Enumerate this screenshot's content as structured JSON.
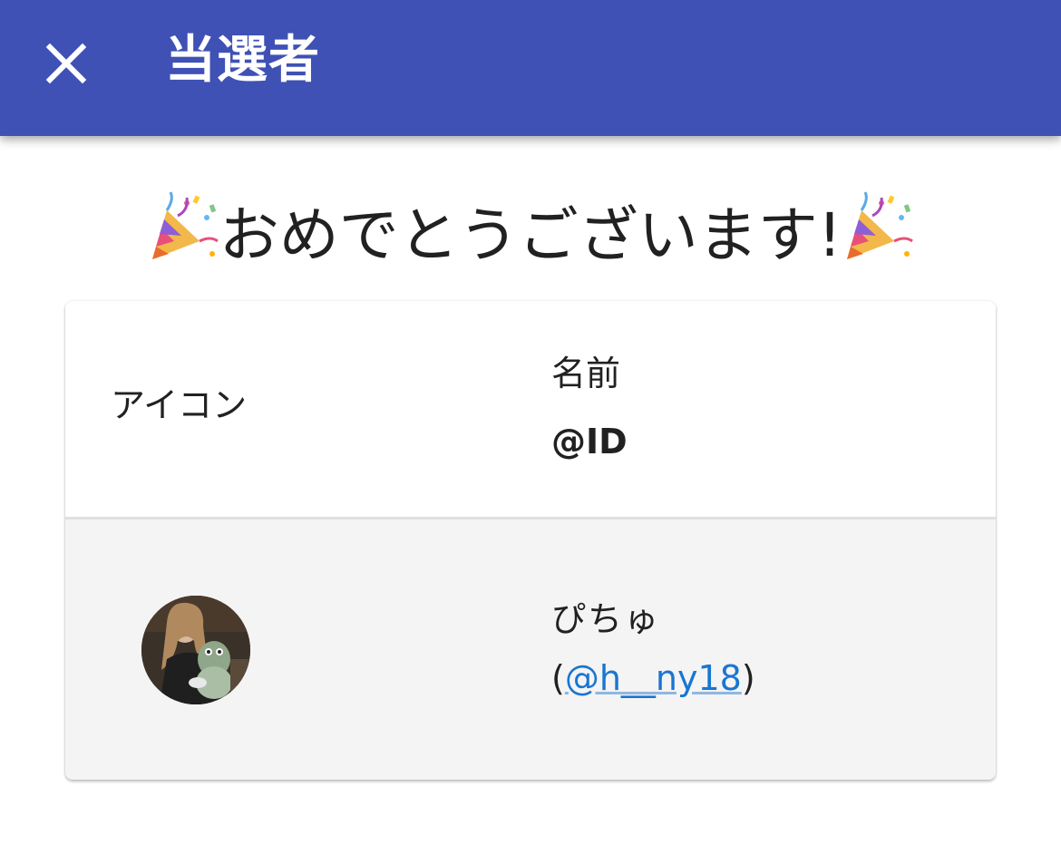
{
  "appbar": {
    "title": "当選者",
    "close_icon": "close-icon",
    "background_color": "#3f51b5"
  },
  "headline": {
    "text": "おめでとうございます!",
    "decoration_icon": "party-popper-icon"
  },
  "table": {
    "header": {
      "icon_label": "アイコン",
      "name_label": "名前",
      "id_label": "@ID"
    },
    "rows": [
      {
        "avatar": "user-avatar",
        "name": "ぴちゅ",
        "id_open": "(",
        "id_handle": "@h__ny18",
        "id_close": ")"
      }
    ]
  },
  "link_color": "#1976d2"
}
